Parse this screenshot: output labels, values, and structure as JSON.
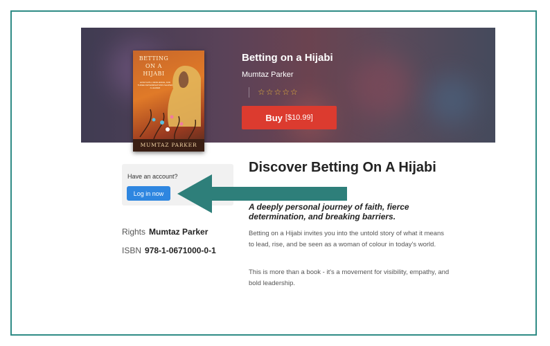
{
  "book": {
    "title": "Betting on a Hijabi",
    "author": "Mumtaz Parker",
    "rating_stars": "☆☆☆☆☆",
    "buy_label": "Buy",
    "buy_price": "[$10.99]",
    "cover": {
      "title_line1": "BETTING",
      "title_line2": "ON A",
      "title_line3": "HIJABI",
      "subtitle": "HOW FAITH, RESILIENCE, AND THREE DETERMINATIONS SHAPED A LEADER",
      "author": "MUMTAZ PARKER"
    }
  },
  "account": {
    "question": "Have an account?",
    "login_label": "Log in now"
  },
  "details": {
    "rights_label": "Rights",
    "rights_value": "Mumtaz Parker",
    "isbn_label": "ISBN",
    "isbn_value": "978-1-0671000-0-1"
  },
  "description": {
    "heading": "Discover Betting On A Hijabi",
    "tagline": "A deeply personal journey of faith, fierce determination, and breaking barriers.",
    "para1": "Betting on a Hijabi invites you into the untold story of what it means to lead, rise, and be seen as a woman of colour in today's world.",
    "para2": "This is more than a book - it's a movement for visibility, empathy, and bold leadership."
  },
  "colors": {
    "frame": "#2e8b85",
    "arrow": "#2e7f7a",
    "buy": "#dc3b2f",
    "login": "#2e86e0",
    "stars": "#e8b53a"
  },
  "icons": {
    "arrow": "left-arrow-icon",
    "star": "star-outline-icon"
  }
}
